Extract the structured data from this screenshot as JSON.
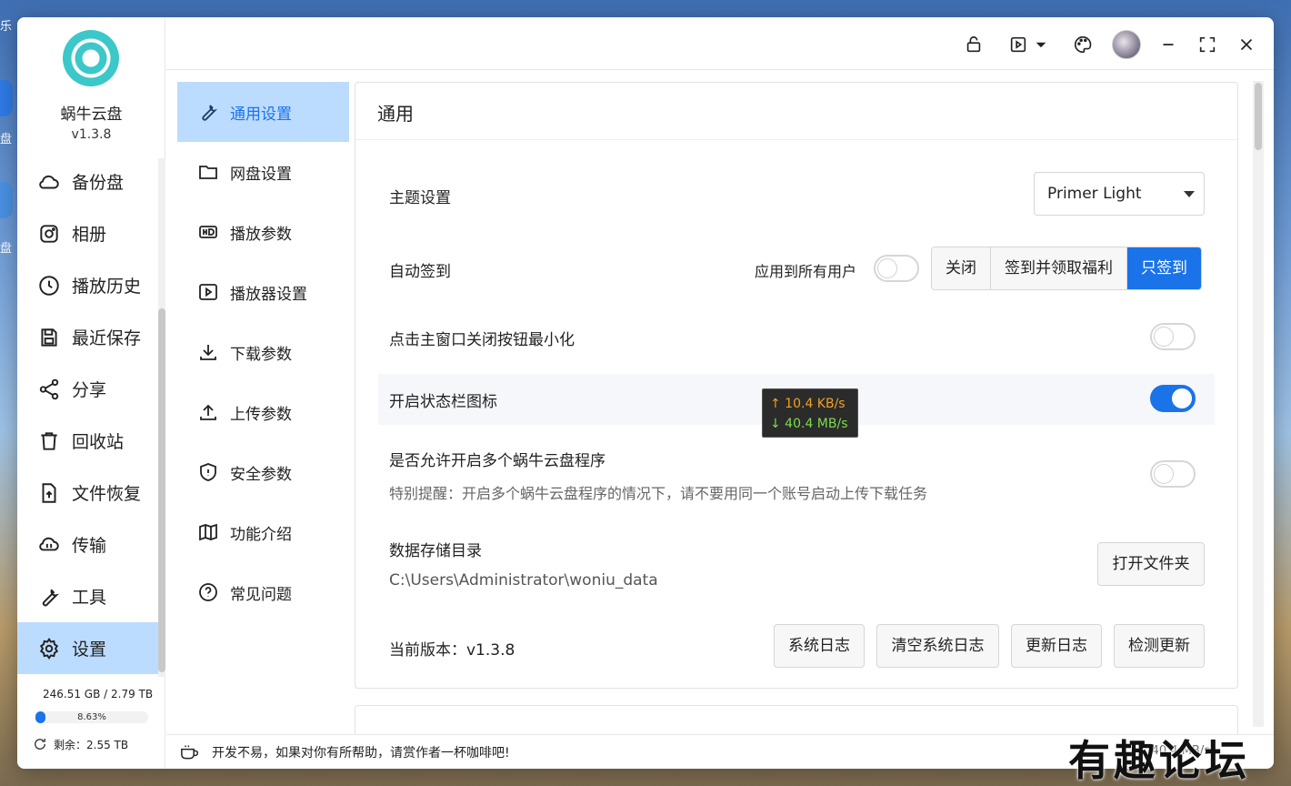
{
  "desktop": {
    "label_top": "乐",
    "label_mid1": "盘",
    "label_mid2": "盘"
  },
  "sidebar": {
    "app_name": "蜗牛云盘",
    "version": "v1.3.8",
    "items": [
      {
        "label": "备份盘",
        "icon": "cloud-icon"
      },
      {
        "label": "相册",
        "icon": "instagram-icon"
      },
      {
        "label": "播放历史",
        "icon": "clock-icon"
      },
      {
        "label": "最近保存",
        "icon": "save-icon"
      },
      {
        "label": "分享",
        "icon": "share-icon"
      },
      {
        "label": "回收站",
        "icon": "trash-icon"
      },
      {
        "label": "文件恢复",
        "icon": "file-restore-icon"
      },
      {
        "label": "传输",
        "icon": "transfer-icon"
      },
      {
        "label": "工具",
        "icon": "wrench-icon"
      },
      {
        "label": "设置",
        "icon": "gear-icon",
        "active": true
      }
    ],
    "quota_text": "246.51 GB / 2.79 TB",
    "quota_percent_label": "8.63%",
    "quota_fraction": 0.0863,
    "remain_text": "剩余：2.55 TB"
  },
  "submenu": {
    "items": [
      {
        "label": "通用设置",
        "icon": "wrench-icon",
        "active": true
      },
      {
        "label": "网盘设置",
        "icon": "folder-icon"
      },
      {
        "label": "播放参数",
        "icon": "hd-icon"
      },
      {
        "label": "播放器设置",
        "icon": "play-icon"
      },
      {
        "label": "下载参数",
        "icon": "download-icon"
      },
      {
        "label": "上传参数",
        "icon": "upload-icon"
      },
      {
        "label": "安全参数",
        "icon": "shield-icon"
      },
      {
        "label": "功能介绍",
        "icon": "map-icon"
      },
      {
        "label": "常见问题",
        "icon": "question-icon"
      }
    ]
  },
  "general": {
    "title": "通用",
    "theme_label": "主题设置",
    "theme_value": "Primer Light",
    "autosign_label": "自动签到",
    "apply_all_label": "应用到所有用户",
    "apply_all_on": false,
    "autosign_options": [
      "关闭",
      "签到并领取福利",
      "只签到"
    ],
    "autosign_selected": "只签到",
    "minimize_label": "点击主窗口关闭按钮最小化",
    "minimize_on": false,
    "tray_label": "开启状态栏图标",
    "tray_on": true,
    "multi_label": "是否允许开启多个蜗牛云盘程序",
    "multi_note": "特别提醒：开启多个蜗牛云盘程序的情况下，请不要用同一个账号启动上传下载任务",
    "multi_on": false,
    "data_dir_label": "数据存储目录",
    "data_dir_path": "C:\\Users\\Administrator\\woniu_data",
    "open_folder_button": "打开文件夹",
    "version_label": "当前版本：v1.3.8",
    "buttons": [
      "系统日志",
      "清空系统日志",
      "更新日志",
      "检测更新"
    ]
  },
  "tooltip": {
    "upload": "↑ 10.4 KB/s",
    "download": "↓ 40.4 MB/s"
  },
  "footer": {
    "message": "开发不易，如果对你有所帮助，请赏作者一杯咖啡吧!",
    "speed": "↓ 40.4 MB/s"
  },
  "watermark": "有趣论坛",
  "colors": {
    "accent": "#1a73e8",
    "active_bg": "#bcdcff",
    "logo": "#3cc7c9"
  }
}
